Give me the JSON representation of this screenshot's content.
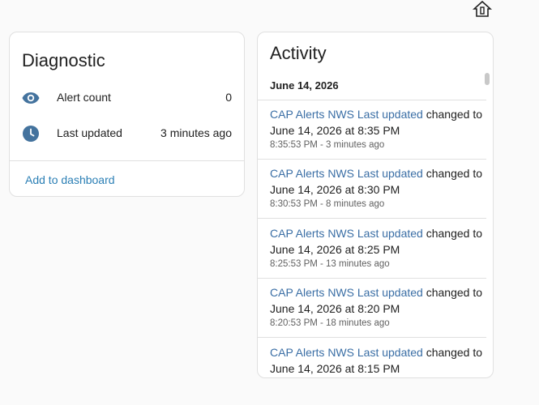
{
  "diagnostic": {
    "title": "Diagnostic",
    "rows": [
      {
        "label": "Alert count",
        "value": "0",
        "icon": "eye-icon"
      },
      {
        "label": "Last updated",
        "value": "3 minutes ago",
        "icon": "clock-icon"
      }
    ],
    "add_link": "Add to dashboard"
  },
  "activity": {
    "title": "Activity",
    "date_heading": "June 14, 2026",
    "entries": [
      {
        "entity": "CAP Alerts NWS Last updated",
        "action": " changed to",
        "value": "June 14, 2026 at 8:35 PM",
        "meta": "8:35:53 PM - 3 minutes ago"
      },
      {
        "entity": "CAP Alerts NWS Last updated",
        "action": " changed to",
        "value": "June 14, 2026 at 8:30 PM",
        "meta": "8:30:53 PM - 8 minutes ago"
      },
      {
        "entity": "CAP Alerts NWS Last updated",
        "action": " changed to",
        "value": "June 14, 2026 at 8:25 PM",
        "meta": "8:25:53 PM - 13 minutes ago"
      },
      {
        "entity": "CAP Alerts NWS Last updated",
        "action": " changed to",
        "value": "June 14, 2026 at 8:20 PM",
        "meta": "8:20:53 PM - 18 minutes ago"
      },
      {
        "entity": "CAP Alerts NWS Last updated",
        "action": " changed to",
        "value": "June 14, 2026 at 8:15 PM",
        "meta": ""
      }
    ]
  },
  "colors": {
    "link": "#2b7fb5",
    "entity": "#3a6ea5",
    "icon": "#44739e"
  }
}
